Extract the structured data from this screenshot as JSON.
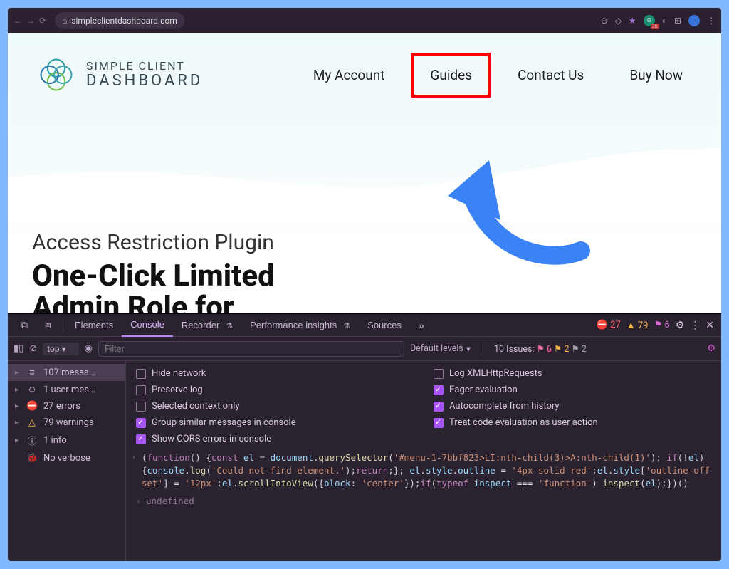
{
  "browser": {
    "url": "simpleclientdashboard.com"
  },
  "site": {
    "logo_line1": "SIMPLE CLIENT",
    "logo_line2": "DASHBOARD",
    "nav": {
      "my_account": "My Account",
      "guides": "Guides",
      "contact": "Contact Us",
      "buy": "Buy Now"
    },
    "kicker": "Access Restriction Plugin",
    "hero_line1": "One-Click Limited",
    "hero_line2": "Admin Role for"
  },
  "devtools": {
    "tabs": {
      "elements": "Elements",
      "console": "Console",
      "recorder": "Recorder",
      "perf": "Performance insights",
      "sources": "Sources"
    },
    "counts": {
      "errors": "27",
      "warnings": "79",
      "messages": "6"
    },
    "subbar": {
      "context": "top",
      "filter_placeholder": "Filter",
      "levels": "Default levels",
      "issues_label": "10 Issues:",
      "issues_r": "6",
      "issues_y": "2",
      "issues_b": "2"
    },
    "sidebar": {
      "messages": "107 messa…",
      "user": "1 user mes…",
      "errors": "27 errors",
      "warnings": "79 warnings",
      "info": "1 info",
      "verbose": "No verbose"
    },
    "options": {
      "hide_network": "Hide network",
      "preserve_log": "Preserve log",
      "selected_ctx": "Selected context only",
      "group": "Group similar messages in console",
      "cors": "Show CORS errors in console",
      "log_xhr": "Log XMLHttpRequests",
      "eager": "Eager evaluation",
      "auto": "Autocomplete from history",
      "treat": "Treat code evaluation as user action"
    },
    "code_tokens": [
      {
        "t": "op",
        "v": "("
      },
      {
        "t": "kw",
        "v": "function"
      },
      {
        "t": "op",
        "v": "() {"
      },
      {
        "t": "kw",
        "v": "const"
      },
      {
        "t": "op",
        "v": " "
      },
      {
        "t": "id",
        "v": "el"
      },
      {
        "t": "op",
        "v": " = "
      },
      {
        "t": "id",
        "v": "document"
      },
      {
        "t": "op",
        "v": "."
      },
      {
        "t": "fn",
        "v": "querySelector"
      },
      {
        "t": "op",
        "v": "("
      },
      {
        "t": "str",
        "v": "'#menu-1-7bbf823>LI:nth-child(3)>A:nth-child(1)'"
      },
      {
        "t": "op",
        "v": "); "
      },
      {
        "t": "kw",
        "v": "if"
      },
      {
        "t": "op",
        "v": "(!"
      },
      {
        "t": "id",
        "v": "el"
      },
      {
        "t": "op",
        "v": ") {"
      },
      {
        "t": "id",
        "v": "console"
      },
      {
        "t": "op",
        "v": "."
      },
      {
        "t": "fn",
        "v": "log"
      },
      {
        "t": "op",
        "v": "("
      },
      {
        "t": "str",
        "v": "'Could not find element.'"
      },
      {
        "t": "op",
        "v": ");"
      },
      {
        "t": "kw",
        "v": "return"
      },
      {
        "t": "op",
        "v": ";}; "
      },
      {
        "t": "id",
        "v": "el"
      },
      {
        "t": "op",
        "v": "."
      },
      {
        "t": "id",
        "v": "style"
      },
      {
        "t": "op",
        "v": "."
      },
      {
        "t": "id",
        "v": "outline"
      },
      {
        "t": "op",
        "v": " = "
      },
      {
        "t": "str",
        "v": "'4px solid red'"
      },
      {
        "t": "op",
        "v": ";"
      },
      {
        "t": "id",
        "v": "el"
      },
      {
        "t": "op",
        "v": "."
      },
      {
        "t": "id",
        "v": "style"
      },
      {
        "t": "op",
        "v": "["
      },
      {
        "t": "str",
        "v": "'outline-offset'"
      },
      {
        "t": "op",
        "v": "] = "
      },
      {
        "t": "str",
        "v": "'12px'"
      },
      {
        "t": "op",
        "v": ";"
      },
      {
        "t": "id",
        "v": "el"
      },
      {
        "t": "op",
        "v": "."
      },
      {
        "t": "fn",
        "v": "scrollIntoView"
      },
      {
        "t": "op",
        "v": "({"
      },
      {
        "t": "id",
        "v": "block"
      },
      {
        "t": "op",
        "v": ": "
      },
      {
        "t": "str",
        "v": "'center'"
      },
      {
        "t": "op",
        "v": "});"
      },
      {
        "t": "kw",
        "v": "if"
      },
      {
        "t": "op",
        "v": "("
      },
      {
        "t": "kw",
        "v": "typeof"
      },
      {
        "t": "op",
        "v": " "
      },
      {
        "t": "id",
        "v": "inspect"
      },
      {
        "t": "op",
        "v": " === "
      },
      {
        "t": "str",
        "v": "'function'"
      },
      {
        "t": "op",
        "v": ") "
      },
      {
        "t": "fn",
        "v": "inspect"
      },
      {
        "t": "op",
        "v": "("
      },
      {
        "t": "id",
        "v": "el"
      },
      {
        "t": "op",
        "v": ");})()"
      }
    ],
    "undefined_label": "undefined"
  }
}
